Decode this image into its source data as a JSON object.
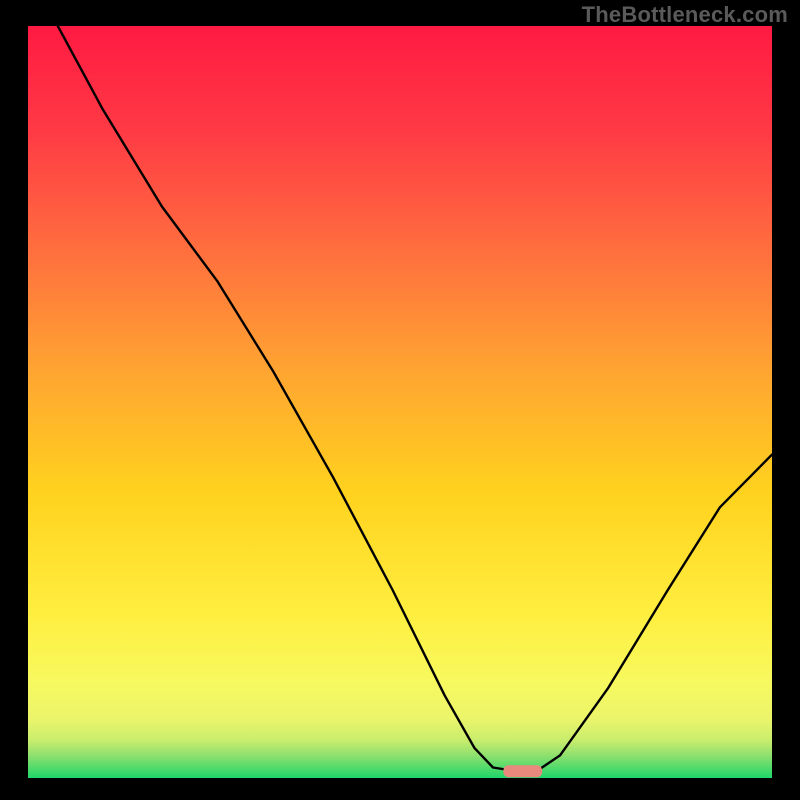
{
  "watermark": "TheBottleneck.com",
  "chart_data": {
    "type": "line",
    "title": "",
    "xlabel": "",
    "ylabel": "",
    "xlim": [
      0,
      100
    ],
    "ylim": [
      0,
      100
    ],
    "background_gradient": {
      "top": "#ff1a42",
      "upper_mid": "#ff7a3a",
      "mid": "#ffd21e",
      "lower_mid": "#ffee55",
      "near_bottom": "#e8f56a",
      "bottom": "#1fd66a"
    },
    "curve": {
      "comment": "V-shaped curve; left limb starts near top-left, descends, bends shallower mid-left, then dives to the trough near x≈65%; right limb rises toward upper-right but only to ~43% height.",
      "points": [
        {
          "x": 4.0,
          "y": 100.0
        },
        {
          "x": 10.0,
          "y": 89.0
        },
        {
          "x": 18.0,
          "y": 76.0
        },
        {
          "x": 25.5,
          "y": 66.0
        },
        {
          "x": 33.0,
          "y": 54.0
        },
        {
          "x": 41.0,
          "y": 40.0
        },
        {
          "x": 49.0,
          "y": 25.0
        },
        {
          "x": 56.0,
          "y": 11.0
        },
        {
          "x": 60.0,
          "y": 4.0
        },
        {
          "x": 62.5,
          "y": 1.4
        },
        {
          "x": 65.0,
          "y": 1.0
        },
        {
          "x": 68.5,
          "y": 1.0
        },
        {
          "x": 71.5,
          "y": 3.0
        },
        {
          "x": 78.0,
          "y": 12.0
        },
        {
          "x": 86.0,
          "y": 25.0
        },
        {
          "x": 93.0,
          "y": 36.0
        },
        {
          "x": 100.0,
          "y": 43.0
        }
      ]
    },
    "marker": {
      "comment": "small salmon rounded pill at the trough on the baseline",
      "x": 66.5,
      "y": 0.9,
      "width_pct": 5.2,
      "height_pct": 1.6,
      "color": "#e9897e"
    }
  }
}
